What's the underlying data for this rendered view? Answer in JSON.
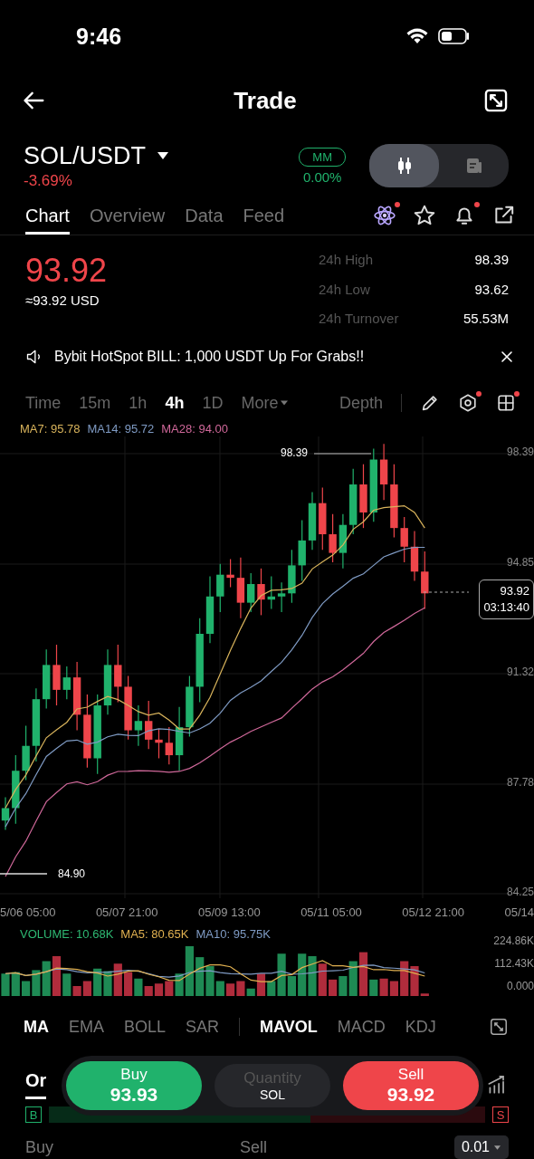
{
  "status_bar": {
    "time": "9:46"
  },
  "header": {
    "title": "Trade"
  },
  "pair": {
    "symbol": "SOL/USDT",
    "change": "-3.69%",
    "badge": "MM",
    "badge_value": "0.00%"
  },
  "view_toggle": [
    {
      "kind": "candles",
      "selected": true
    },
    {
      "kind": "document",
      "selected": false
    }
  ],
  "tabs": [
    {
      "label": "Chart",
      "selected": true
    },
    {
      "label": "Overview",
      "selected": false
    },
    {
      "label": "Data",
      "selected": false
    },
    {
      "label": "Feed",
      "selected": false
    }
  ],
  "tab_icons": [
    {
      "kind": "atom",
      "dot": true
    },
    {
      "kind": "star",
      "dot": false
    },
    {
      "kind": "bell",
      "dot": true
    },
    {
      "kind": "share",
      "dot": false
    }
  ],
  "price": {
    "last": "93.92",
    "usd": "≈93.92 USD"
  },
  "stats": [
    {
      "label": "24h High",
      "value": "98.39"
    },
    {
      "label": "24h Low",
      "value": "93.62"
    },
    {
      "label": "24h Turnover",
      "value": "55.53M"
    }
  ],
  "banner": {
    "text": "Bybit HotSpot BILL: 1,000 USDT Up For Grabs!!"
  },
  "intervals": [
    {
      "label": "Time",
      "selected": false,
      "kind": "plain"
    },
    {
      "label": "15m",
      "selected": false,
      "kind": "plain"
    },
    {
      "label": "1h",
      "selected": false,
      "kind": "plain"
    },
    {
      "label": "4h",
      "selected": true,
      "kind": "plain"
    },
    {
      "label": "1D",
      "selected": false,
      "kind": "plain"
    },
    {
      "label": "More",
      "selected": false,
      "kind": "menu"
    }
  ],
  "depth": "Depth",
  "tools": [
    {
      "kind": "pencil",
      "dot": false
    },
    {
      "kind": "hexagon",
      "dot": true
    },
    {
      "kind": "grid",
      "dot": true
    }
  ],
  "ma_legend": [
    {
      "label": "MA7: 95.78",
      "color": "#d9b45c"
    },
    {
      "label": "MA14: 95.72",
      "color": "#7f9bc4"
    },
    {
      "label": "MA28: 94.00",
      "color": "#d0689a"
    }
  ],
  "chart": {
    "y_labels": [
      "98.39",
      "94.85",
      "91.32",
      "87.78",
      "84.25"
    ],
    "x_labels": [
      "5/06 05:00",
      "05/07 21:00",
      "05/09 13:00",
      "05/11 05:00",
      "05/12 21:00",
      "05/14"
    ],
    "high_label": "98.39",
    "low_label": "84.90",
    "last_price": "93.92",
    "countdown": "03:13:40"
  },
  "volume": {
    "legend": [
      {
        "label": "VOLUME: 10.68K",
        "color": "#2eb872"
      },
      {
        "label": "MA5: 80.65K",
        "color": "#e0b050"
      },
      {
        "label": "MA10: 95.75K",
        "color": "#7f9bc4"
      }
    ],
    "y_labels": [
      "224.86K",
      "112.43K",
      "0.000"
    ]
  },
  "indicators": [
    {
      "label": "MA",
      "selected": true
    },
    {
      "label": "EMA",
      "selected": false
    },
    {
      "label": "BOLL",
      "selected": false
    },
    {
      "label": "SAR",
      "selected": false
    },
    {
      "label": "MAVOL",
      "selected": true
    },
    {
      "label": "MACD",
      "selected": false
    },
    {
      "label": "KDJ",
      "selected": false
    }
  ],
  "order_tab": "Or",
  "trade_bar": {
    "buy_label": "Buy",
    "buy_price": "93.93",
    "quantity_placeholder": "Quantity",
    "unit": "SOL",
    "sell_label": "Sell",
    "sell_price": "93.92"
  },
  "depth_badges": [
    "B",
    "S"
  ],
  "footer": {
    "buy": "Buy",
    "sell": "Sell",
    "step": "0.01"
  }
}
